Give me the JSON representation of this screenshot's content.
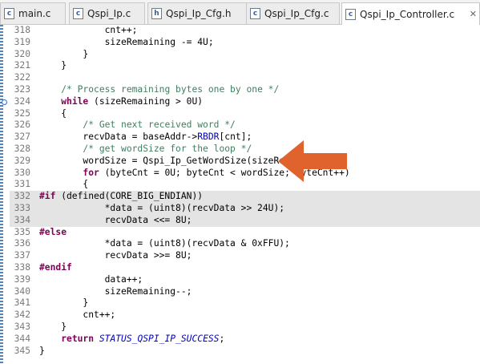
{
  "tabs": [
    {
      "label": "main.c",
      "active": false
    },
    {
      "label": "Qspi_Ip.c",
      "active": false
    },
    {
      "label": "Qspi_Ip_Cfg.h",
      "active": false
    },
    {
      "label": "Qspi_Ip_Cfg.c",
      "active": false
    },
    {
      "label": "Qspi_Ip_Controller.c",
      "active": true
    }
  ],
  "editor": {
    "colors": {
      "keyword": "#7f0055",
      "comment": "#3f7f5f",
      "constant": "#0000c0",
      "highlight": "#e4e4e4",
      "arrow": "#e0622d"
    },
    "lines": [
      {
        "n": "318",
        "tokens": [
          [
            "",
            "            cnt++;"
          ]
        ]
      },
      {
        "n": "319",
        "tokens": [
          [
            "",
            "            sizeRemaining -= 4U;"
          ]
        ]
      },
      {
        "n": "320",
        "tokens": [
          [
            "",
            "        }"
          ]
        ]
      },
      {
        "n": "321",
        "tokens": [
          [
            "",
            "    }"
          ]
        ]
      },
      {
        "n": "322",
        "tokens": [
          [
            "",
            ""
          ]
        ]
      },
      {
        "n": "323",
        "tokens": [
          [
            "",
            "    "
          ],
          [
            "cm",
            "/* Process remaining bytes one by one */"
          ]
        ]
      },
      {
        "n": "324",
        "tokens": [
          [
            "",
            "    "
          ],
          [
            "kw",
            "while"
          ],
          [
            "",
            " (sizeRemaining > 0U)"
          ]
        ],
        "marker": true
      },
      {
        "n": "325",
        "tokens": [
          [
            "",
            "    {"
          ]
        ]
      },
      {
        "n": "326",
        "tokens": [
          [
            "",
            "        "
          ],
          [
            "cm",
            "/* Get next received word */"
          ]
        ]
      },
      {
        "n": "327",
        "tokens": [
          [
            "",
            "        recvData = baseAddr->"
          ],
          [
            "fld",
            "RBDR"
          ],
          [
            "",
            "[cnt];"
          ]
        ]
      },
      {
        "n": "328",
        "tokens": [
          [
            "",
            "        "
          ],
          [
            "cm",
            "/* get wordSize for the loop */"
          ]
        ]
      },
      {
        "n": "329",
        "tokens": [
          [
            "",
            "        wordSize = Qspi_Ip_GetWordSize(sizeRemaining);"
          ]
        ]
      },
      {
        "n": "330",
        "tokens": [
          [
            "",
            "        "
          ],
          [
            "kw",
            "for"
          ],
          [
            "",
            " (byteCnt = 0U; byteCnt < wordSize; byteCnt++)"
          ]
        ]
      },
      {
        "n": "331",
        "tokens": [
          [
            "",
            "        {"
          ]
        ]
      },
      {
        "n": "332",
        "tokens": [
          [
            "kw",
            "#if"
          ],
          [
            "",
            " (defined(CORE_BIG_ENDIAN))"
          ]
        ],
        "hl": true
      },
      {
        "n": "333",
        "tokens": [
          [
            "",
            "            *data = (uint8)(recvData >> 24U);"
          ]
        ],
        "hl": true
      },
      {
        "n": "334",
        "tokens": [
          [
            "",
            "            recvData <<= 8U;"
          ]
        ],
        "hl": true
      },
      {
        "n": "335",
        "tokens": [
          [
            "kw",
            "#else"
          ]
        ]
      },
      {
        "n": "336",
        "tokens": [
          [
            "",
            "            *data = (uint8)(recvData & 0xFFU);"
          ]
        ]
      },
      {
        "n": "337",
        "tokens": [
          [
            "",
            "            recvData >>= 8U;"
          ]
        ]
      },
      {
        "n": "338",
        "tokens": [
          [
            "kw",
            "#endif"
          ]
        ]
      },
      {
        "n": "339",
        "tokens": [
          [
            "",
            "            data++;"
          ]
        ]
      },
      {
        "n": "340",
        "tokens": [
          [
            "",
            "            sizeRemaining--;"
          ]
        ]
      },
      {
        "n": "341",
        "tokens": [
          [
            "",
            "        }"
          ]
        ]
      },
      {
        "n": "342",
        "tokens": [
          [
            "",
            "        cnt++;"
          ]
        ]
      },
      {
        "n": "343",
        "tokens": [
          [
            "",
            "    }"
          ]
        ]
      },
      {
        "n": "344",
        "tokens": [
          [
            "",
            "    "
          ],
          [
            "kw",
            "return"
          ],
          [
            "",
            " "
          ],
          [
            "it",
            "STATUS_QSPI_IP_SUCCESS"
          ],
          [
            "",
            ";"
          ]
        ]
      },
      {
        "n": "345",
        "tokens": [
          [
            "",
            "}"
          ]
        ]
      }
    ]
  },
  "icons": {
    "file_tab": "c-source-file-icon",
    "close": "close-icon",
    "annotation": "arrow-left-icon"
  }
}
